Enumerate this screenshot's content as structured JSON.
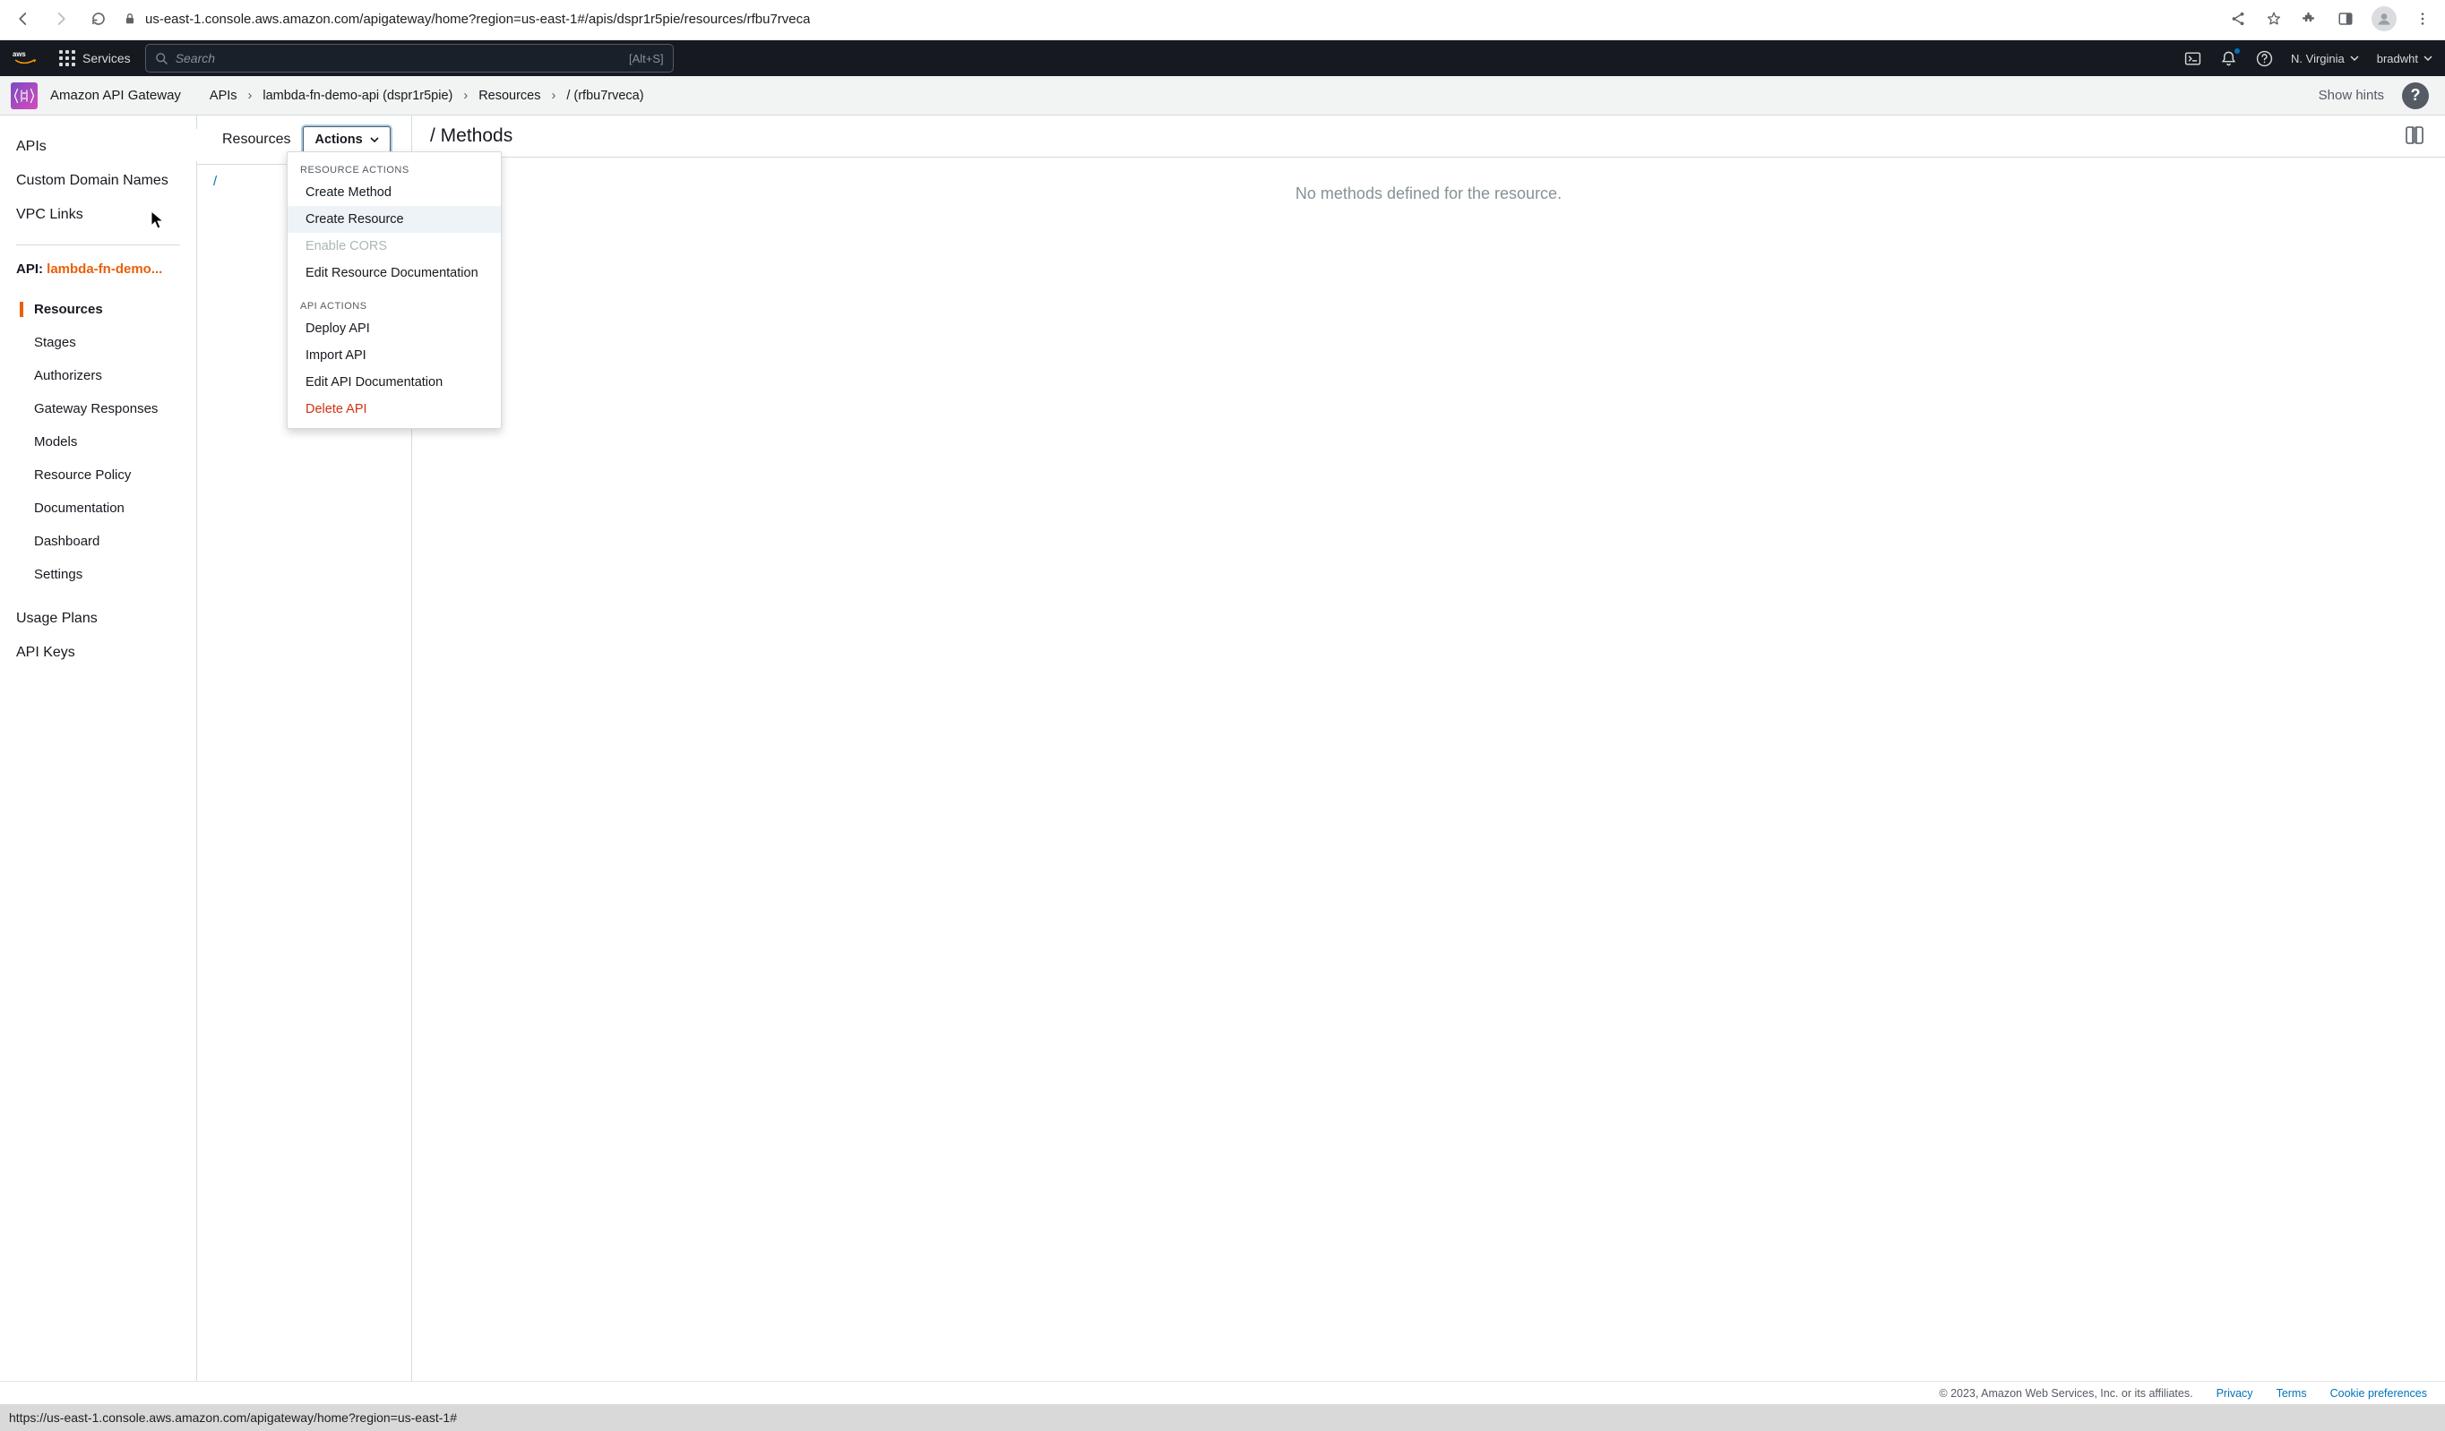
{
  "browser": {
    "url": "us-east-1.console.aws.amazon.com/apigateway/home?region=us-east-1#/apis/dspr1r5pie/resources/rfbu7rveca",
    "status_url": "https://us-east-1.console.aws.amazon.com/apigateway/home?region=us-east-1#"
  },
  "topbar": {
    "services": "Services",
    "search_placeholder": "Search",
    "search_shortcut": "[Alt+S]",
    "region": "N. Virginia",
    "user": "bradwht"
  },
  "breadcrumb": {
    "service": "Amazon API Gateway",
    "items": [
      "APIs",
      "lambda-fn-demo-api (dspr1r5pie)",
      "Resources",
      "/ (rfbu7rveca)"
    ],
    "show_hints": "Show hints"
  },
  "sidebar": {
    "top": [
      "APIs",
      "Custom Domain Names",
      "VPC Links"
    ],
    "api_prefix": "API: ",
    "api_name": "lambda-fn-demo...",
    "sub": [
      "Resources",
      "Stages",
      "Authorizers",
      "Gateway Responses",
      "Models",
      "Resource Policy",
      "Documentation",
      "Dashboard",
      "Settings"
    ],
    "bottom": [
      "Usage Plans",
      "API Keys"
    ]
  },
  "resources": {
    "title": "Resources",
    "actions_label": "Actions",
    "tree_root": "/"
  },
  "dropdown": {
    "heading_resource": "RESOURCE ACTIONS",
    "resource_items": [
      "Create Method",
      "Create Resource",
      "Enable CORS",
      "Edit Resource Documentation"
    ],
    "heading_api": "API ACTIONS",
    "api_items": [
      "Deploy API",
      "Import API",
      "Edit API Documentation",
      "Delete API"
    ]
  },
  "methods": {
    "title": "/ Methods",
    "empty": "No methods defined for the resource."
  },
  "footer": {
    "copyright": "© 2023, Amazon Web Services, Inc. or its affiliates.",
    "privacy": "Privacy",
    "terms": "Terms",
    "cookie": "Cookie preferences"
  }
}
